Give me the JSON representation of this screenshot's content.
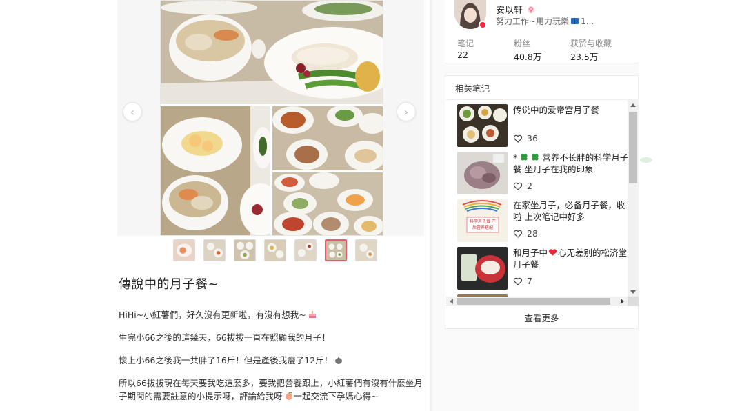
{
  "carousel": {
    "prev_glyph": "‹",
    "next_glyph": "›",
    "thumbnail_count": 7,
    "active_thumbnail": 6
  },
  "post": {
    "title": "傳說中的月子餐~",
    "paragraphs": [
      "HiHi~小紅薯們，好久沒有更新啦，有沒有想我~",
      "生完小66之後的這幾天，66拔拔一直在照顧我的月子！",
      "懷上小66之後我一共胖了16斤！但是產後我瘦了12斤！",
      "所以66拔拔現在每天要我吃這麼多，要我把營養跟上，小紅薯們有沒有什麼坐月子期間的需要註意的小提示呀，評論給我呀",
      "一起交流下孕媽心得~"
    ]
  },
  "author": {
    "name": "安以轩",
    "bio": "努力工作~用力玩樂",
    "bio_suffix": "1...",
    "stats": [
      {
        "label": "笔记",
        "value": "22"
      },
      {
        "label": "粉丝",
        "value": "40.8万"
      },
      {
        "label": "获赞与收藏",
        "value": "23.5万"
      }
    ]
  },
  "related": {
    "title": "相关笔记",
    "see_more": "查看更多",
    "items": [
      {
        "title": "传说中的爱帝宫月子餐",
        "likes": "36"
      },
      {
        "title_prefix": "*",
        "title": "营养不长胖的科学月子餐 坐月子在我的印象",
        "likes": "2"
      },
      {
        "title": "在家坐月子，必备月子餐，收啦 上次笔记中好多",
        "likes": "28"
      },
      {
        "title_a": "和月子中",
        "title_b": "心无差别的松济堂月子餐",
        "likes": "7"
      }
    ],
    "thumb3_caption": "科学月子餐 产后营养搭配"
  },
  "colors": {
    "accent": "#ff2442",
    "clover": "#2e9b3e",
    "text": "#333333"
  }
}
